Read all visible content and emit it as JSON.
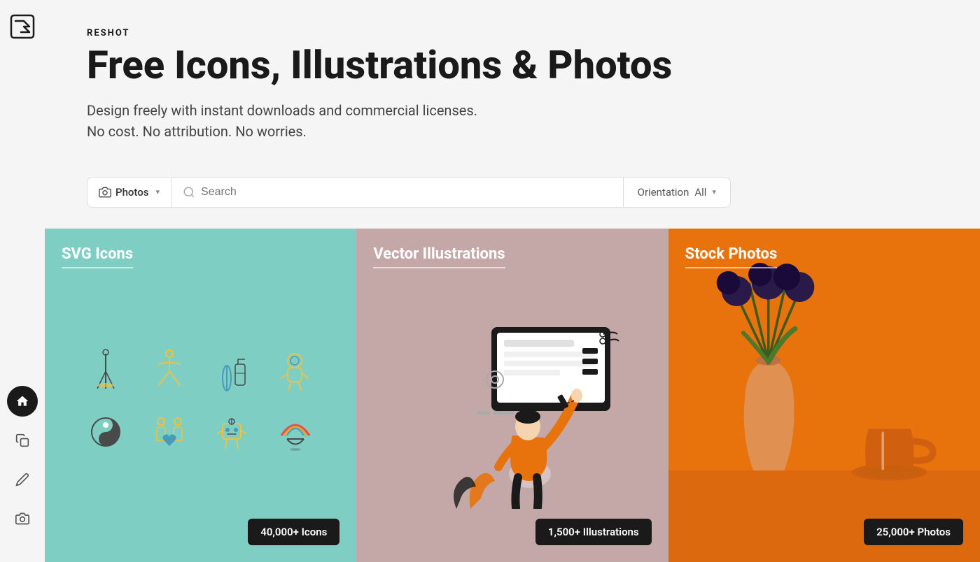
{
  "brand": {
    "name": "RESHOT",
    "logo_alt": "Reshot logo"
  },
  "hero": {
    "title": "Free Icons, Illustrations & Photos",
    "subtitle_line1": "Design freely with instant downloads and commercial licenses.",
    "subtitle_line2": "No cost. No attribution. No worries."
  },
  "search": {
    "type_label": "Photos",
    "placeholder": "Search",
    "orientation_label": "Orientation",
    "orientation_value": "All"
  },
  "cards": [
    {
      "id": "svg-icons",
      "label": "SVG Icons",
      "badge": "40,000+ Icons",
      "bg_color": "#7ecec4"
    },
    {
      "id": "vector-illustrations",
      "label": "Vector Illustrations",
      "badge": "1,500+ Illustrations",
      "bg_color": "#c4a8a8"
    },
    {
      "id": "stock-photos",
      "label": "Stock Photos",
      "badge": "25,000+ Photos",
      "bg_color": "#e8720c"
    }
  ],
  "sidebar": {
    "nav_items": [
      {
        "id": "home",
        "label": "Home",
        "active": true
      },
      {
        "id": "shapes",
        "label": "Shapes",
        "active": false
      },
      {
        "id": "pen",
        "label": "Pen tool",
        "active": false
      },
      {
        "id": "camera",
        "label": "Camera",
        "active": false
      }
    ]
  }
}
